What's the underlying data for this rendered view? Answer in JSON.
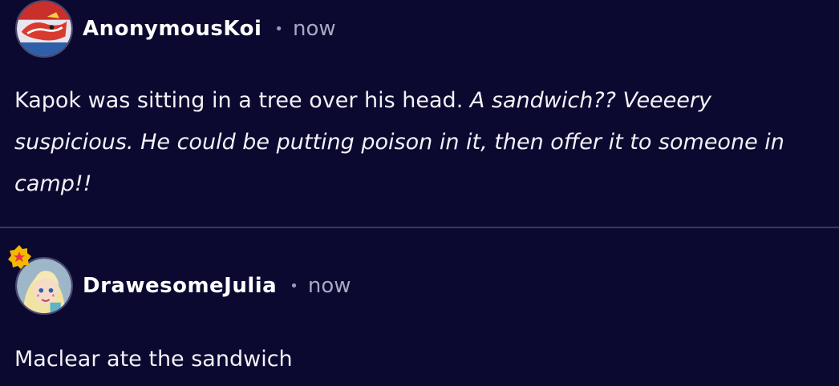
{
  "comments": [
    {
      "username": "AnonymousKoi",
      "separator": "•",
      "time": "now",
      "avatar_icon": "user-avatar-koi",
      "text_plain": "Kapok was sitting in a tree over his head. ",
      "text_italic": "A sandwich?? Veeeery suspicious. He could be putting poison in it, then offer it to someone in camp!!"
    },
    {
      "username": "DrawesomeJulia",
      "separator": "•",
      "time": "now",
      "avatar_icon": "user-avatar-star",
      "badge_icon": "star-badge-icon",
      "text_plain": "Maclear ate the sandwich"
    }
  ],
  "colors": {
    "background": "#0b0930",
    "divider": "#3a3860",
    "text": "#f2f2f7",
    "muted": "#a9a7c4",
    "badge_gold": "#f5b800",
    "badge_star": "#e8334a"
  }
}
